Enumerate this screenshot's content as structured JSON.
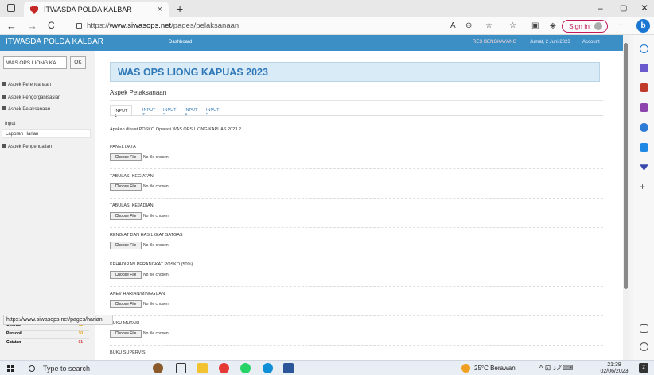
{
  "browser": {
    "tab_title": "ITWASDA POLDA KALBAR",
    "tab_close": "×",
    "new_tab": "+",
    "url_prefix": "https://",
    "url_domain": "www.siwasops.net",
    "url_path": "/pages/pelaksanaan",
    "sign_in": "Sign in",
    "more": "···",
    "window_min": "–",
    "window_max": "▢",
    "window_close": "✕",
    "back": "←",
    "forward": "→",
    "refresh": "C",
    "status_url": "https://www.siwasops.net/pages/harian"
  },
  "app": {
    "brand": "ITWASDA POLDA KALBAR",
    "dashboard": "Dashboard",
    "user": "RES BENGKAYANG",
    "date": "Jumat, 2 Juni 2023",
    "account": "Account"
  },
  "sidebar": {
    "select_value": "WAS OPS LIONG KA",
    "ok": "OK",
    "items": [
      {
        "label": "Aspek Perencanaan"
      },
      {
        "label": "Aspek Pengorganisasian"
      },
      {
        "label": "Aspek Pelaksanaan"
      },
      {
        "label": "Aspek Pengendalian"
      }
    ],
    "subitems": [
      {
        "label": "Input"
      },
      {
        "label": "Laporan Harian"
      }
    ],
    "stats": [
      {
        "label": "Operasi",
        "value": "11"
      },
      {
        "label": "Personil",
        "value": "10"
      },
      {
        "label": "Catatan",
        "value": "01"
      }
    ]
  },
  "main": {
    "title": "WAS OPS LIONG KAPUAS 2023",
    "subtitle": "Aspek Petaksanaan",
    "tabs": [
      {
        "label": "INPUT 1"
      },
      {
        "label": "INPUT 2"
      },
      {
        "label": "INPUT 3"
      },
      {
        "label": "INPUT 4"
      },
      {
        "label": "INPUT 5"
      }
    ],
    "question": "Apakah dibuat POSKO Operasi WAS OPS LIONG KAPUAS 2023 ?",
    "choose_file": "Choose File",
    "no_file": "No file chosen",
    "fields": [
      {
        "label": "PANEL DATA"
      },
      {
        "label": "TABULASI KEGIATAN"
      },
      {
        "label": "TABULASI KEJADIAN"
      },
      {
        "label": "RENGIAT DAN HASIL GIAT SATGAS"
      },
      {
        "label": "KEHADIRAN PERANGKAT POSKO (50%)"
      },
      {
        "label": "ANEV HARIAN/MINGGUAN"
      },
      {
        "label": "BUKU MUTASI"
      },
      {
        "label": "BUKU SUPERVISI"
      }
    ]
  },
  "taskbar": {
    "search_placeholder": "Type to search",
    "weather": "25°C Berawan",
    "time": "21:38",
    "date": "02/06/2023",
    "notif_count": "2"
  }
}
